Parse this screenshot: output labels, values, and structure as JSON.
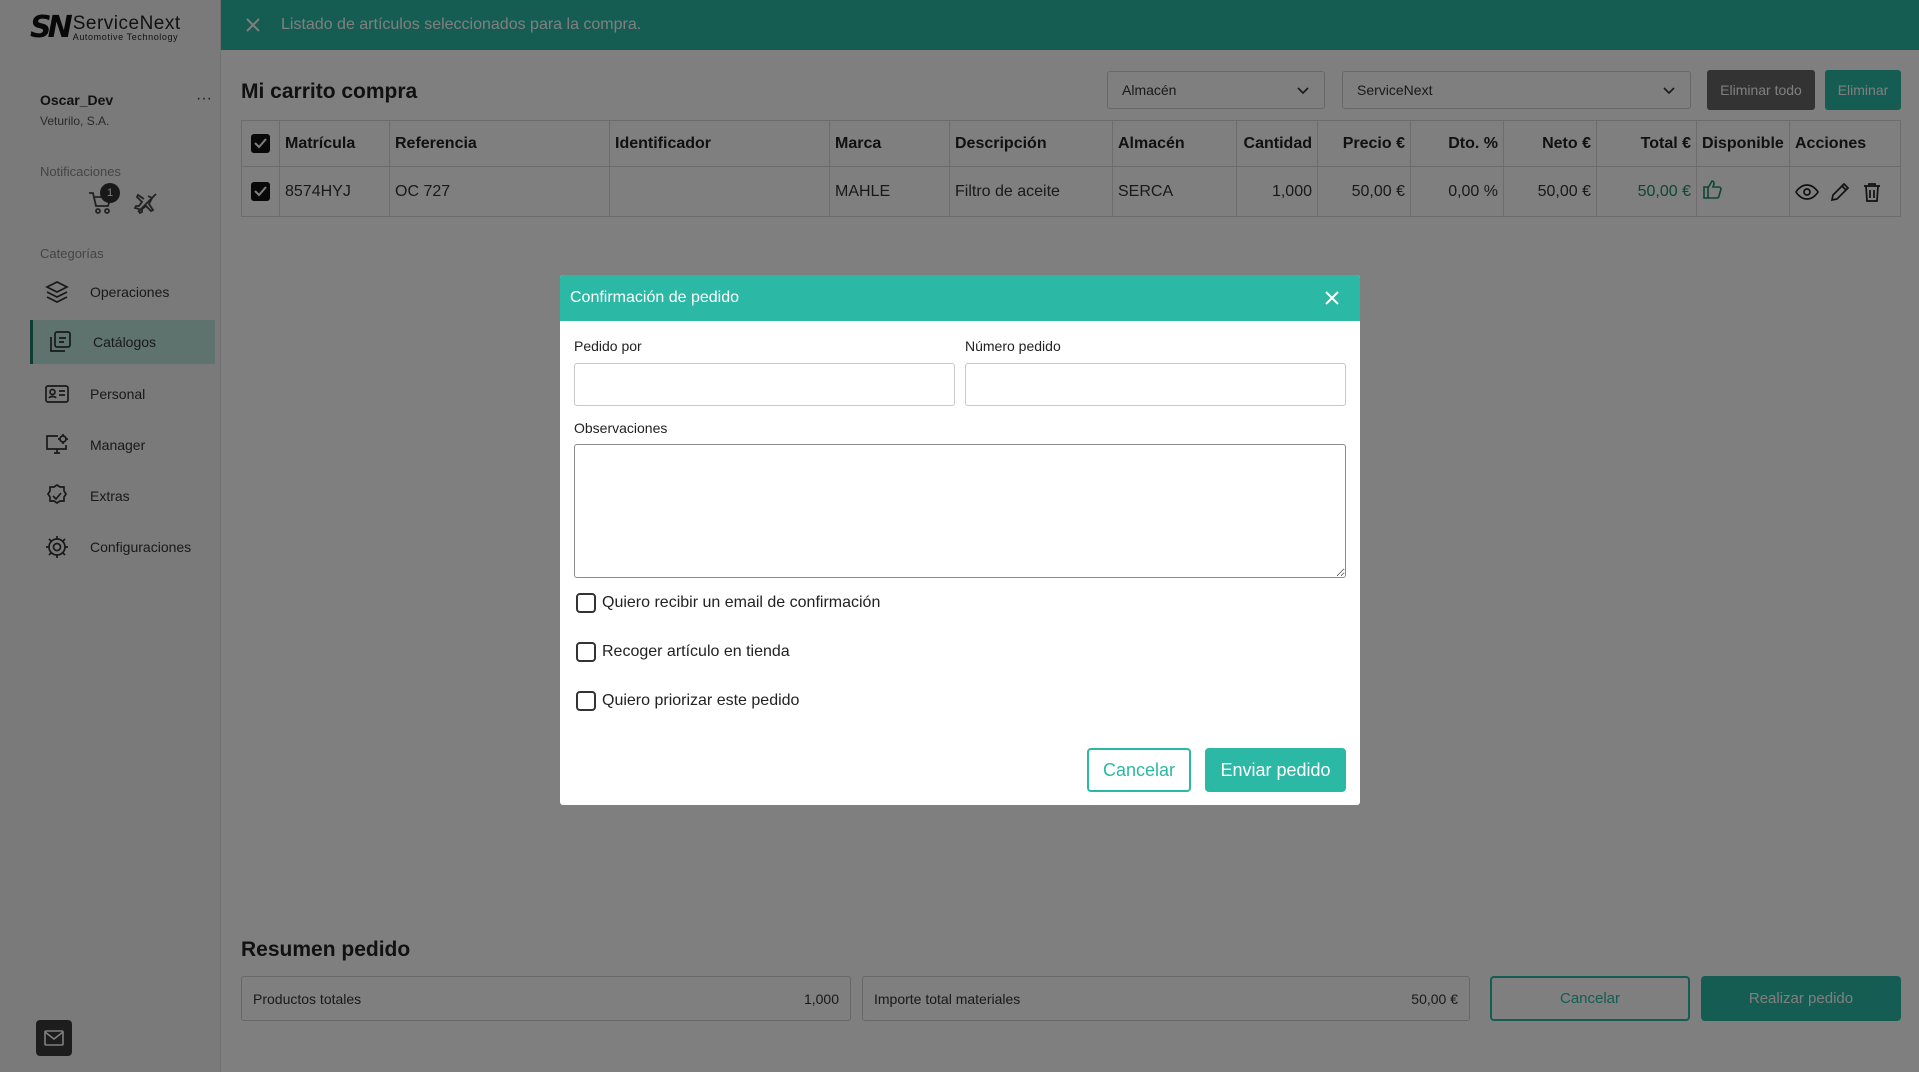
{
  "brand": {
    "mark": "SN",
    "name": "ServiceNext",
    "tagline": "Automotive Technology"
  },
  "user": {
    "name": "Oscar_Dev",
    "company": "Veturilo, S.A.",
    "menu_glyph": "···"
  },
  "notifications": {
    "label": "Notificaciones",
    "cart_badge": "1"
  },
  "categories": {
    "label": "Categorías",
    "items": [
      {
        "label": "Operaciones",
        "icon": "layers-icon"
      },
      {
        "label": "Catálogos",
        "icon": "catalog-icon",
        "active": true
      },
      {
        "label": "Personal",
        "icon": "id-card-icon"
      },
      {
        "label": "Manager",
        "icon": "monitor-gear-icon"
      },
      {
        "label": "Extras",
        "icon": "badge-check-icon"
      },
      {
        "label": "Configuraciones",
        "icon": "gear-icon"
      }
    ]
  },
  "topbar": {
    "message": "Listado de artículos seleccionados para la compra."
  },
  "page": {
    "title": "Mi carrito compra",
    "warehouse_select": "Almacén",
    "provider_select": "ServiceNext",
    "delete_all_label": "Eliminar todo",
    "delete_label": "Eliminar"
  },
  "table": {
    "headers": [
      "Matrícula",
      "Referencia",
      "Identificador",
      "Marca",
      "Descripción",
      "Almacén",
      "Cantidad",
      "Precio €",
      "Dto. %",
      "Neto €",
      "Total €",
      "Disponible",
      "Acciones"
    ],
    "rows": [
      {
        "matricula": "8574HYJ",
        "referencia": "OC 727",
        "identificador": "",
        "marca": "MAHLE",
        "descripcion": "Filtro de aceite",
        "almacen": "SERCA",
        "cantidad": "1,000",
        "precio": "50,00 €",
        "dto": "0,00 %",
        "neto": "50,00 €",
        "total": "50,00 €"
      }
    ]
  },
  "summary": {
    "title": "Resumen pedido",
    "products_label": "Productos totales",
    "products_value": "1,000",
    "amount_label": "Importe total materiales",
    "amount_value": "50,00 €",
    "cancel_label": "Cancelar",
    "submit_label": "Realizar pedido"
  },
  "modal": {
    "title": "Confirmación de pedido",
    "ordered_by_label": "Pedido por",
    "ordered_by_value": "",
    "order_number_label": "Número pedido",
    "order_number_value": "",
    "notes_label": "Observaciones",
    "notes_value": "",
    "checkboxes": [
      {
        "label": "Quiero recibir un email de confirmación",
        "checked": false
      },
      {
        "label": "Recoger artículo en tienda",
        "checked": false
      },
      {
        "label": "Quiero priorizar este pedido",
        "checked": false
      }
    ],
    "cancel_label": "Cancelar",
    "send_label": "Enviar pedido"
  },
  "colors": {
    "accent": "#2bb8a4",
    "accent_dark": "#1e7a66",
    "total_green": "#1a8a6e"
  }
}
